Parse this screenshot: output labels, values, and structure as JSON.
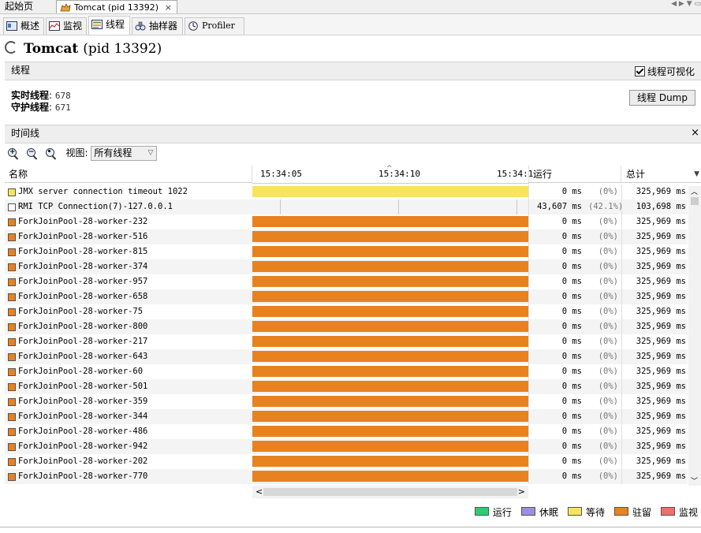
{
  "editor_tabs": [
    {
      "label": "起始页"
    },
    {
      "label": "Tomcat (pid 13392)",
      "close": "×"
    }
  ],
  "view_tabs": [
    {
      "label": "概述",
      "icon": "overview-icon"
    },
    {
      "label": "监视",
      "icon": "monitor-icon"
    },
    {
      "label": "线程",
      "icon": "threads-icon",
      "active": true
    },
    {
      "label": "抽样器",
      "icon": "sampler-icon"
    },
    {
      "label": "Profiler",
      "icon": "profiler-icon"
    }
  ],
  "title": {
    "app": "Tomcat",
    "pid": "(pid 13392)"
  },
  "threads_section": {
    "label": "线程",
    "visualize_label": "线程可视化",
    "visualize_checked": true
  },
  "stats": {
    "live_label": "实时线程",
    "live_value": "678",
    "daemon_label": "守护线程",
    "daemon_value": "671"
  },
  "dump_button": "线程 Dump",
  "timeline_section": {
    "label": "时间线",
    "close": "×"
  },
  "toolbar": {
    "view_label": "视图:",
    "view_value": "所有线程"
  },
  "table": {
    "col_name": "名称",
    "col_running": "运行",
    "col_total": "总计",
    "ticks": [
      "15:34:05",
      "15:34:10",
      "15:34:1"
    ],
    "rows": [
      {
        "name": "JMX server connection timeout 1022",
        "state": "wait",
        "run": "0 ms",
        "pct": "(0%)",
        "total": "325,969 ms"
      },
      {
        "name": "RMI TCP Connection(7)-127.0.0.1",
        "state": "none",
        "run": "43,607 ms",
        "pct": "(42.1%)",
        "total": "103,698 ms"
      },
      {
        "name": "ForkJoinPool-28-worker-232",
        "state": "park",
        "run": "0 ms",
        "pct": "(0%)",
        "total": "325,969 ms"
      },
      {
        "name": "ForkJoinPool-28-worker-516",
        "state": "park",
        "run": "0 ms",
        "pct": "(0%)",
        "total": "325,969 ms"
      },
      {
        "name": "ForkJoinPool-28-worker-815",
        "state": "park",
        "run": "0 ms",
        "pct": "(0%)",
        "total": "325,969 ms"
      },
      {
        "name": "ForkJoinPool-28-worker-374",
        "state": "park",
        "run": "0 ms",
        "pct": "(0%)",
        "total": "325,969 ms"
      },
      {
        "name": "ForkJoinPool-28-worker-957",
        "state": "park",
        "run": "0 ms",
        "pct": "(0%)",
        "total": "325,969 ms"
      },
      {
        "name": "ForkJoinPool-28-worker-658",
        "state": "park",
        "run": "0 ms",
        "pct": "(0%)",
        "total": "325,969 ms"
      },
      {
        "name": "ForkJoinPool-28-worker-75",
        "state": "park",
        "run": "0 ms",
        "pct": "(0%)",
        "total": "325,969 ms"
      },
      {
        "name": "ForkJoinPool-28-worker-800",
        "state": "park",
        "run": "0 ms",
        "pct": "(0%)",
        "total": "325,969 ms"
      },
      {
        "name": "ForkJoinPool-28-worker-217",
        "state": "park",
        "run": "0 ms",
        "pct": "(0%)",
        "total": "325,969 ms"
      },
      {
        "name": "ForkJoinPool-28-worker-643",
        "state": "park",
        "run": "0 ms",
        "pct": "(0%)",
        "total": "325,969 ms"
      },
      {
        "name": "ForkJoinPool-28-worker-60",
        "state": "park",
        "run": "0 ms",
        "pct": "(0%)",
        "total": "325,969 ms"
      },
      {
        "name": "ForkJoinPool-28-worker-501",
        "state": "park",
        "run": "0 ms",
        "pct": "(0%)",
        "total": "325,969 ms"
      },
      {
        "name": "ForkJoinPool-28-worker-359",
        "state": "park",
        "run": "0 ms",
        "pct": "(0%)",
        "total": "325,969 ms"
      },
      {
        "name": "ForkJoinPool-28-worker-344",
        "state": "park",
        "run": "0 ms",
        "pct": "(0%)",
        "total": "325,969 ms"
      },
      {
        "name": "ForkJoinPool-28-worker-486",
        "state": "park",
        "run": "0 ms",
        "pct": "(0%)",
        "total": "325,969 ms"
      },
      {
        "name": "ForkJoinPool-28-worker-942",
        "state": "park",
        "run": "0 ms",
        "pct": "(0%)",
        "total": "325,969 ms"
      },
      {
        "name": "ForkJoinPool-28-worker-202",
        "state": "park",
        "run": "0 ms",
        "pct": "(0%)",
        "total": "325,969 ms"
      },
      {
        "name": "ForkJoinPool-28-worker-770",
        "state": "park",
        "run": "0 ms",
        "pct": "(0%)",
        "total": "325,969 ms"
      }
    ]
  },
  "legend": [
    {
      "label": "运行",
      "color": "#2ecc71",
      "key": "running"
    },
    {
      "label": "休眠",
      "color": "#9b8fe0",
      "key": "sleeping"
    },
    {
      "label": "等待",
      "color": "#f7e45c",
      "key": "wait"
    },
    {
      "label": "驻留",
      "color": "#e8821e",
      "key": "park"
    },
    {
      "label": "监视",
      "color": "#f06e6e",
      "key": "monitor"
    }
  ],
  "state_colors": {
    "wait": "#f7e45c",
    "park": "#e8821e",
    "none": "#ffffff"
  }
}
